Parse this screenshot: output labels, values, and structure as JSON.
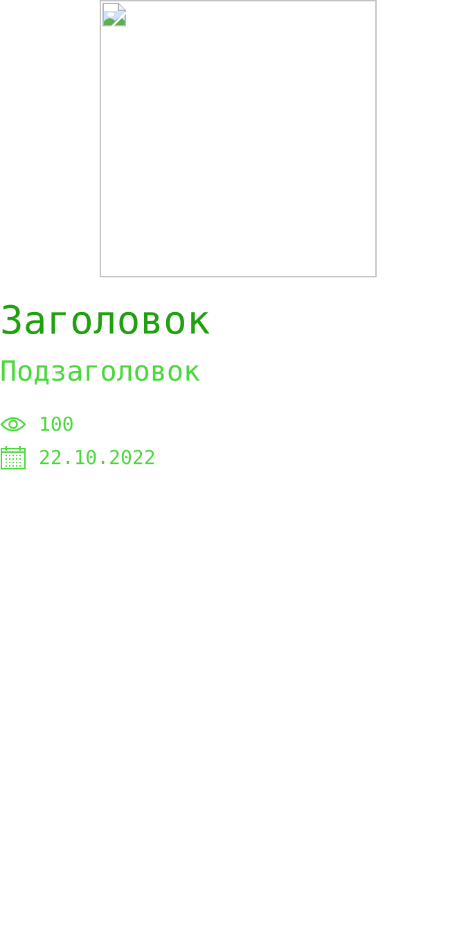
{
  "article": {
    "title": "Заголовок",
    "subtitle": "Подзаголовок",
    "views": "100",
    "date": "22.10.2022"
  },
  "icons": {
    "views": "eye-icon",
    "date": "calendar-icon",
    "image": "broken-image-icon"
  },
  "colors": {
    "title": "#1fa00f",
    "accent": "#49d83a",
    "image_border": "#c4c4c4"
  }
}
